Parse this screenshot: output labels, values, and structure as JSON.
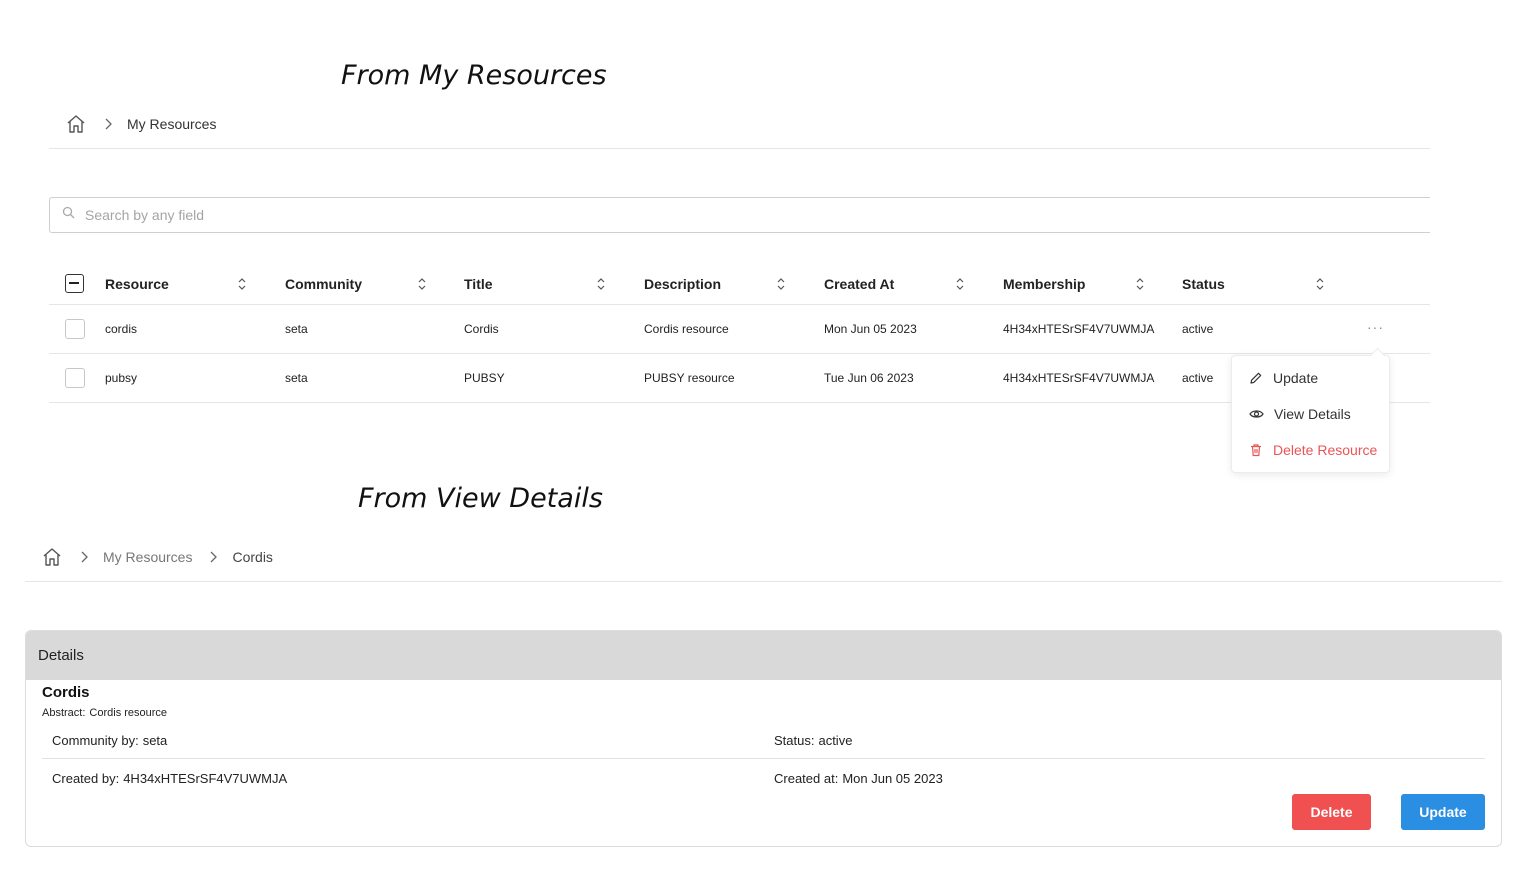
{
  "section1": {
    "heading": "From My Resources",
    "breadcrumb": [
      "My Resources"
    ],
    "search": {
      "placeholder": "Search by any field"
    },
    "table": {
      "columns": [
        "Resource",
        "Community",
        "Title",
        "Description",
        "Created At",
        "Membership",
        "Status"
      ],
      "rows": [
        {
          "resource": "cordis",
          "community": "seta",
          "title": "Cordis",
          "description": "Cordis resource",
          "created_at": "Mon Jun 05 2023",
          "membership": "4H34xHTESrSF4V7UWMJA",
          "status": "active"
        },
        {
          "resource": "pubsy",
          "community": "seta",
          "title": "PUBSY",
          "description": "PUBSY resource",
          "created_at": "Tue Jun 06 2023",
          "membership": "4H34xHTESrSF4V7UWMJA",
          "status": "active"
        }
      ]
    },
    "row_menu": {
      "trigger": "···",
      "update": "Update",
      "view_details": "View Details",
      "delete": "Delete Resource"
    }
  },
  "section2": {
    "heading": "From View Details",
    "breadcrumb": [
      "My Resources",
      "Cordis"
    ],
    "card": {
      "header": "Details",
      "title": "Cordis",
      "abstract_label": "Abstract:",
      "abstract_value": "Cordis resource",
      "community_label": "Community by:",
      "community_value": "seta",
      "status_label": "Status:",
      "status_value": "active",
      "created_by_label": "Created by:",
      "created_by_value": "4H34xHTESrSF4V7UWMJA",
      "created_at_label": "Created at:",
      "created_at_value": "Mon Jun 05 2023",
      "delete_label": "Delete",
      "update_label": "Update"
    }
  },
  "colors": {
    "danger": "#f05050",
    "primary": "#2a8ee3",
    "card_header": "#d9d9d9"
  },
  "icons": [
    "home-icon",
    "chevron-right-icon",
    "search-icon",
    "sort-icon",
    "more-dots-icon",
    "pencil-icon",
    "eye-icon",
    "trash-icon"
  ]
}
